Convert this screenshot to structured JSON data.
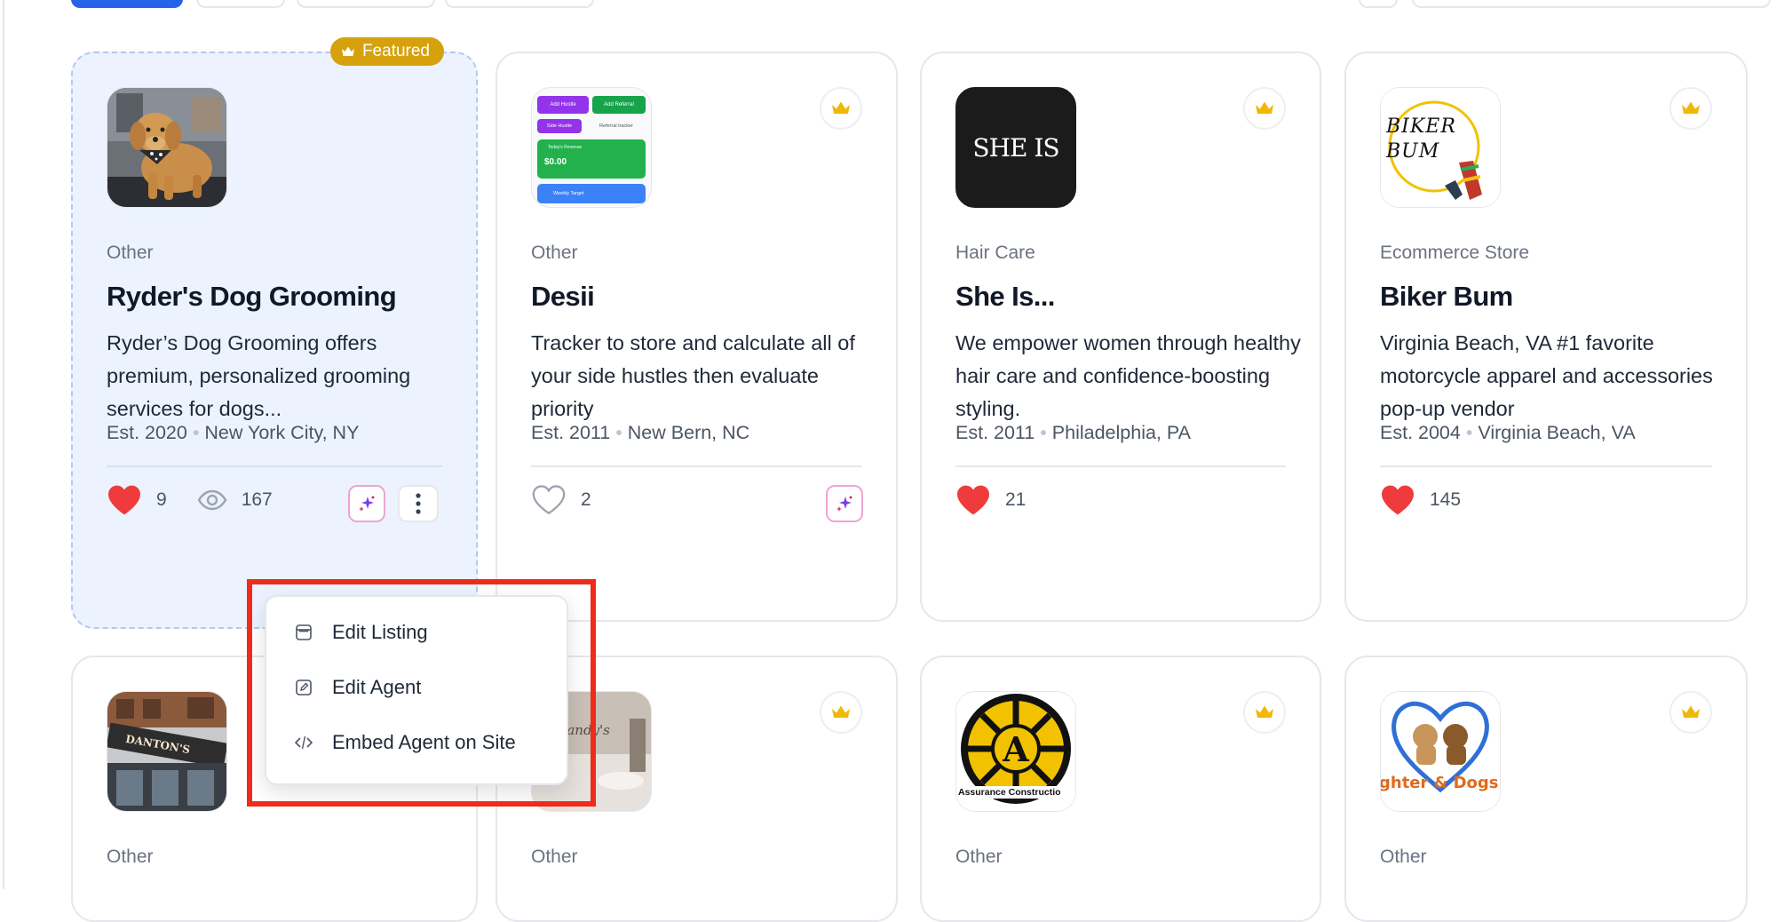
{
  "featured_label": "Featured",
  "cards": [
    {
      "category": "Other",
      "title": "Ryder's Dog Grooming",
      "description": "Ryder’s Dog Grooming offers premium, personalized grooming services for dogs...",
      "est": "Est. 2020",
      "location": "New York City, NY",
      "likes": "9",
      "views": "167"
    },
    {
      "category": "Other",
      "title": "Desii",
      "description": "Tracker to store and calculate all of your side hustles then evaluate priority",
      "est": "Est. 2011",
      "location": "New Bern, NC",
      "likes": "2"
    },
    {
      "category": "Hair Care",
      "title": "She Is...",
      "description": "We empower women through healthy hair care and confidence-boosting styling.",
      "est": "Est. 2011",
      "location": "Philadelphia, PA",
      "likes": "21",
      "logo_text": "SHE IS"
    },
    {
      "category": "Ecommerce Store",
      "title": "Biker Bum",
      "description": "Virginia Beach, VA #1 favorite motorcycle apparel and accessories pop-up vendor",
      "est": "Est. 2004",
      "location": "Virginia Beach, VA",
      "likes": "145",
      "logo_text": "BIKER BUM"
    },
    {
      "category": "Other",
      "sign_text": "DANTON'S"
    },
    {
      "category": "Other",
      "sign_text": "Mandy's"
    },
    {
      "category": "Other",
      "logo_text": "Assurance Constructio"
    },
    {
      "category": "Other",
      "logo_text": "ghter & Dogs"
    }
  ],
  "desii_app": {
    "add_hustle": "Add Hustle",
    "add_referral": "Add Referral",
    "side_hustle": "Side Hustle",
    "referral_tracker": "Referral tracker",
    "todays_revenue": "Today's Revenue",
    "revenue_value": "$0.00",
    "weekly_target": "Weekly Target"
  },
  "menu": {
    "items": [
      {
        "label": "Edit Listing",
        "icon": "storefront-icon"
      },
      {
        "label": "Edit Agent",
        "icon": "edit-square-icon"
      },
      {
        "label": "Embed Agent on Site",
        "icon": "code-icon"
      }
    ]
  },
  "colors": {
    "brand_blue": "#2563eb",
    "featured_gold": "#d6a10c",
    "heart_red": "#ef3b3b",
    "highlight_red": "#ef2b1c"
  }
}
